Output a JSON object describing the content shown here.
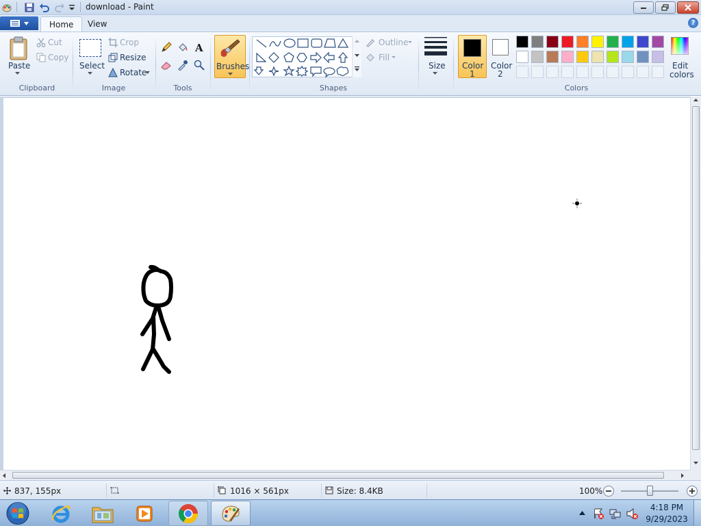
{
  "window": {
    "title": "download - Paint",
    "quick_access": [
      "paint-icon",
      "save-icon",
      "undo-icon",
      "redo-icon",
      "customize-icon"
    ]
  },
  "tabs": {
    "home": "Home",
    "view": "View"
  },
  "clipboard": {
    "paste": "Paste",
    "cut": "Cut",
    "copy": "Copy",
    "label": "Clipboard"
  },
  "image": {
    "select": "Select",
    "crop": "Crop",
    "resize": "Resize",
    "rotate": "Rotate",
    "label": "Image"
  },
  "tools": {
    "label": "Tools"
  },
  "brushes": {
    "label": "Brushes"
  },
  "shapes": {
    "outline": "Outline",
    "fill": "Fill",
    "label": "Shapes"
  },
  "size": {
    "label": "Size"
  },
  "colors_group": {
    "color1_label": "Color",
    "color1_num": "1",
    "color2_label": "Color",
    "color2_num": "2",
    "edit_label_1": "Edit",
    "edit_label_2": "colors",
    "label": "Colors",
    "color1": "#000000",
    "color2": "#ffffff",
    "palette_row1": [
      "#000000",
      "#7f7f7f",
      "#880015",
      "#ed1c24",
      "#ff7f27",
      "#fff200",
      "#22b14c",
      "#00a2e8",
      "#3f48cc",
      "#a349a4"
    ],
    "palette_row2": [
      "#ffffff",
      "#c3c3c3",
      "#b97a57",
      "#ffaec9",
      "#ffc90e",
      "#efe4b0",
      "#b5e61d",
      "#99d9ea",
      "#7092be",
      "#c8bfe7"
    ]
  },
  "status": {
    "cursor_pos": "837, 155px",
    "canvas_size": "1016 × 561px",
    "file_size": "Size: 8.4KB",
    "zoom": "100%",
    "zoom_percent": 100
  },
  "taskbar": {
    "apps": [
      "internet-explorer",
      "file-explorer",
      "media-player",
      "chrome",
      "paint"
    ],
    "time": "4:18 PM",
    "date": "9/29/2023"
  }
}
